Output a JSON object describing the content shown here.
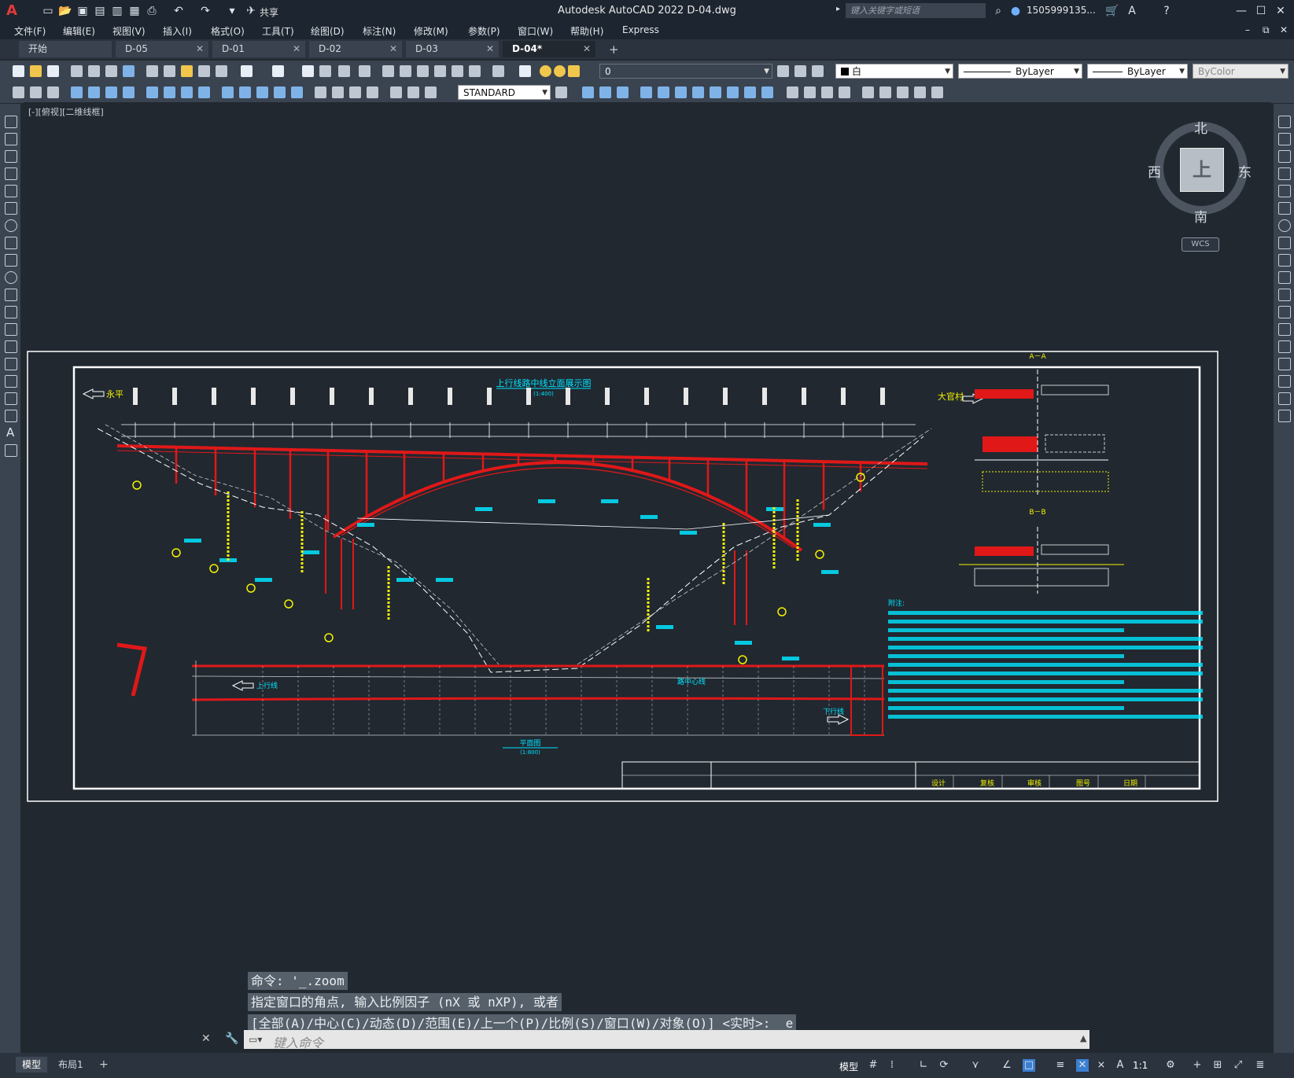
{
  "app": {
    "logo": "A",
    "title": "Autodesk AutoCAD 2022    D-04.dwg",
    "share_label": "共享",
    "search_placeholder": "键入关键字或短语",
    "user": "1505999135..."
  },
  "menu": [
    "文件(F)",
    "编辑(E)",
    "视图(V)",
    "插入(I)",
    "格式(O)",
    "工具(T)",
    "绘图(D)",
    "标注(N)",
    "修改(M)",
    "参数(P)",
    "窗口(W)",
    "帮助(H)",
    "Express"
  ],
  "tabs": [
    {
      "label": "开始",
      "closable": false
    },
    {
      "label": "D-05",
      "closable": true
    },
    {
      "label": "D-01",
      "closable": true
    },
    {
      "label": "D-02",
      "closable": true
    },
    {
      "label": "D-03",
      "closable": true
    },
    {
      "label": "D-04*",
      "closable": true,
      "active": true
    }
  ],
  "properties": {
    "layer": "0",
    "color": "白",
    "linetype": "ByLayer",
    "lineweight": "ByLayer",
    "plotstyle": "ByColor",
    "text_style": "STANDARD"
  },
  "viewport": {
    "label": "[-][俯视][二维线框]",
    "viewcube": {
      "top": "上",
      "north": "北",
      "south": "南",
      "east": "东",
      "west": "西",
      "wcs": "WCS"
    }
  },
  "drawing": {
    "elevation_title": "上行线路中线立面展示图",
    "elevation_scale": "(1:400)",
    "left_direction": "永平",
    "right_direction": "大官村",
    "section_a_title": "A－A",
    "section_b_title": "B－B",
    "plan_title": "平面图",
    "plan_scale": "(1:800)",
    "track_up": "上行线",
    "track_down": "下行线",
    "line_center": "路中心线",
    "notes_title": "附注:",
    "title_block": [
      "设计",
      "复核",
      "审核",
      "图号",
      "日期"
    ],
    "pier_labels": [
      "①",
      "②",
      "③",
      "④",
      "⑤",
      "⑥",
      "⑦",
      "⑧",
      "⑨"
    ]
  },
  "command": {
    "history": [
      "命令: '_.zoom",
      "指定窗口的角点, 输入比例因子 (nX 或 nXP), 或者",
      "[全部(A)/中心(C)/动态(D)/范围(E)/上一个(P)/比例(S)/窗口(W)/对象(O)] <实时>: _e"
    ],
    "input_placeholder": "键入命令"
  },
  "status": {
    "layouts": [
      "模型",
      "布局1"
    ],
    "model_label": "模型",
    "scale": "1:1"
  },
  "colors": {
    "accent": "#e03a3a",
    "drawing_red": "#e01818",
    "drawing_cyan": "#00e5ff",
    "drawing_yellow": "#f2f200"
  }
}
